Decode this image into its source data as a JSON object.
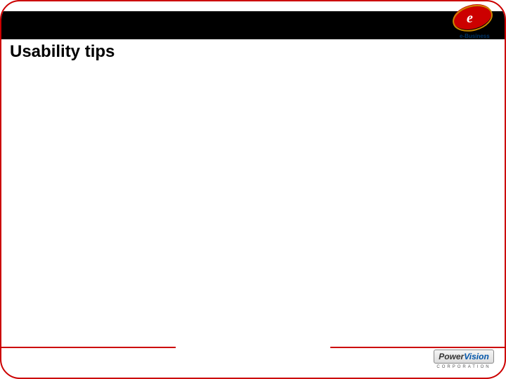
{
  "slide": {
    "title": "Usability tips"
  },
  "logos": {
    "top_right": {
      "mark_letter": "e",
      "label": "e-Business"
    },
    "bottom_right": {
      "word1": "Power",
      "word2": "Vision",
      "subline": "CORPORATION"
    }
  },
  "colors": {
    "border": "#cc0000",
    "topbar": "#000000",
    "accent_blue": "#0055aa"
  }
}
